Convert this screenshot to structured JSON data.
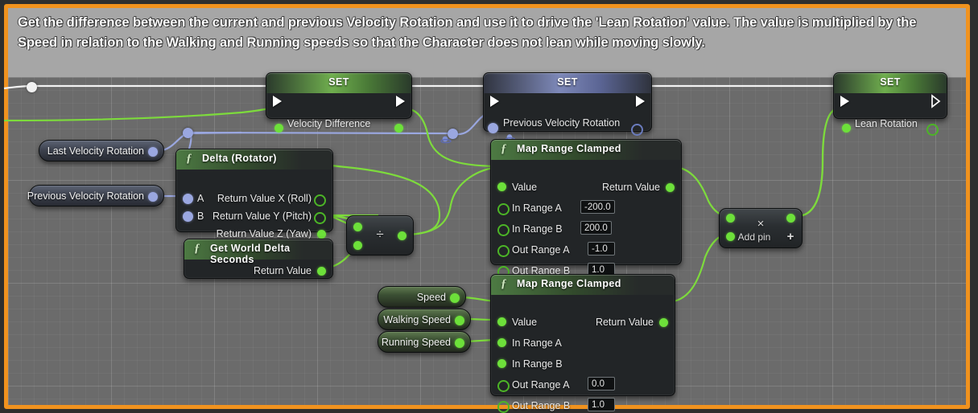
{
  "comment": {
    "text": "Get the difference between the current and previous Velocity Rotation and use it to drive the 'Lean Rotation' value. The value is multiplied by the Speed in relation to the Walking and Running speeds so that the Character does not lean while moving slowly.",
    "border_color": "#f0921e",
    "header_color": "#a6a6a6",
    "body_color": "#6b6b6b"
  },
  "nodes": {
    "set_velocity_difference": {
      "title": "SET",
      "pin_label": "Velocity Difference",
      "header_color": "#6fae4e",
      "type": "set-node"
    },
    "set_previous_velocity_rotation": {
      "title": "SET",
      "pin_label": "Previous Velocity Rotation",
      "header_color": "#7d88b8",
      "type": "set-node",
      "type_icon": "rotator-icon"
    },
    "set_lean_rotation": {
      "title": "SET",
      "pin_label": "Lean Rotation",
      "header_color": "#6fae4e",
      "type": "set-node"
    },
    "delta_rotator": {
      "title": "Delta (Rotator)",
      "function_glyph": "ƒ",
      "inputs": [
        "A",
        "B"
      ],
      "outputs": [
        "Return Value X (Roll)",
        "Return Value Y (Pitch)",
        "Return Value Z (Yaw)"
      ]
    },
    "get_world_delta_seconds": {
      "title": "Get World Delta Seconds",
      "function_glyph": "ƒ",
      "outputs": [
        "Return Value"
      ]
    },
    "divide": {
      "symbol": "÷",
      "name": "divide-node"
    },
    "multiply": {
      "symbol": "×",
      "add_pin_label": "Add pin",
      "add_pin_plus": "+",
      "name": "multiply-node"
    },
    "map_range_clamped_1": {
      "title": "Map Range Clamped",
      "function_glyph": "ƒ",
      "input_value_label": "Value",
      "output_label": "Return Value",
      "params": [
        {
          "label": "In Range A",
          "value": "-200.0"
        },
        {
          "label": "In Range B",
          "value": "200.0"
        },
        {
          "label": "Out Range A",
          "value": "-1.0"
        },
        {
          "label": "Out Range B",
          "value": "1.0"
        }
      ]
    },
    "map_range_clamped_2": {
      "title": "Map Range Clamped",
      "function_glyph": "ƒ",
      "input_value_label": "Value",
      "output_label": "Return Value",
      "params": [
        {
          "label": "In Range A",
          "value": ""
        },
        {
          "label": "In Range B",
          "value": ""
        },
        {
          "label": "Out Range A",
          "value": "0.0"
        },
        {
          "label": "Out Range B",
          "value": "1.0"
        }
      ]
    }
  },
  "getters": {
    "last_velocity_rotation": {
      "label": "Last Velocity Rotation",
      "pin_color": "#9aa7e0"
    },
    "previous_velocity_rotation": {
      "label": "Previous Velocity Rotation",
      "pin_color": "#9aa7e0"
    },
    "speed": {
      "label": "Speed",
      "pin_color": "#6de03a"
    },
    "walking_speed": {
      "label": "Walking Speed",
      "pin_color": "#6de03a"
    },
    "running_speed": {
      "label": "Running Speed",
      "pin_color": "#6de03a"
    }
  },
  "colors": {
    "exec_wire": "#f2f2f2",
    "data_wire_green": "#7ddb3c",
    "data_wire_blue": "#9aa7e0",
    "node_body": "#222527"
  }
}
